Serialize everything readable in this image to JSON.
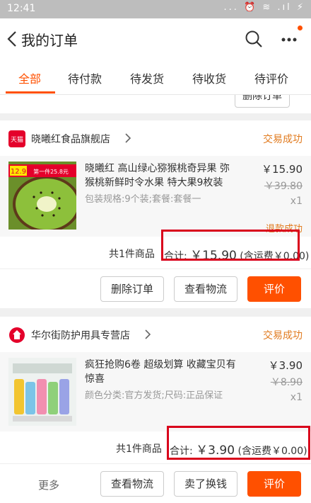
{
  "status_bar": {
    "time": "12:41",
    "icons": "... ⏰ ≋ .ıl ⚡"
  },
  "header": {
    "title": "我的订单"
  },
  "tabs": [
    "全部",
    "待付款",
    "待发货",
    "待收货",
    "待评价"
  ],
  "partial_button": "删除订单",
  "orders": [
    {
      "shop_logo_text": "天猫",
      "shop": "晓曦红食品旗舰店",
      "status": "交易成功",
      "item_title": "晓曦红 高山绿心猕猴桃奇异果 弥猴桃新鲜时令水果 特大果9枚装",
      "sku": "包装规格:9个装;套餐:套餐一",
      "price": "￥15.90",
      "original_price": "￥39.80",
      "qty": "x1",
      "refund": "退款成功",
      "thumb_badge_price": "12.9",
      "thumb_badge_text": "第一件25.8元",
      "count": "共1件商品",
      "total_prefix": "合计: ",
      "total_value": "￥15.90",
      "shipping": "(含运费￥0.00)",
      "buttons": [
        "删除订单",
        "查看物流",
        "评价"
      ]
    },
    {
      "shop": "华尔街防护用具专营店",
      "status": "交易成功",
      "item_title": "疯狂抢购6卷 超级划算 收藏宝贝有惊喜",
      "sku": "颜色分类:官方发货;尺码:正品保证",
      "price": "￥3.90",
      "original_price": "￥8.90",
      "qty": "x1",
      "count": "共1件商品",
      "total_prefix": "合计: ",
      "total_value": "￥3.90",
      "shipping": "(含运费￥0.00)",
      "more": "更多",
      "buttons": [
        "查看物流",
        "卖了换钱",
        "评价"
      ]
    }
  ],
  "colors": {
    "accent": "#ff5000",
    "status_text": "#e17b1f",
    "highlight_box": "#d9001b"
  }
}
